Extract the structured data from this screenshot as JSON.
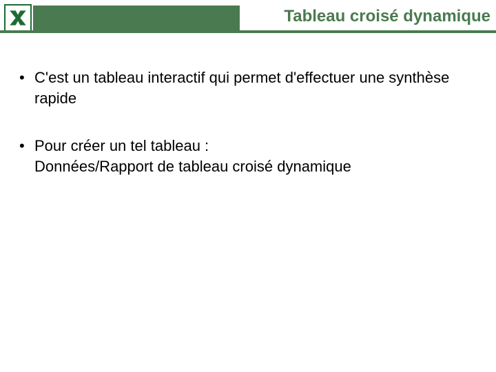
{
  "header": {
    "title": "Tableau croisé dynamique",
    "icon": "excel-x-icon"
  },
  "bullets": [
    {
      "text": "C'est un tableau interactif qui permet d'effectuer une synthèse rapide"
    },
    {
      "text": "Pour créer un tel tableau :",
      "subline": "Données/Rapport de tableau croisé dynamique"
    }
  ],
  "colors": {
    "accent": "#4a7a4f",
    "border": "#1e6b34"
  }
}
